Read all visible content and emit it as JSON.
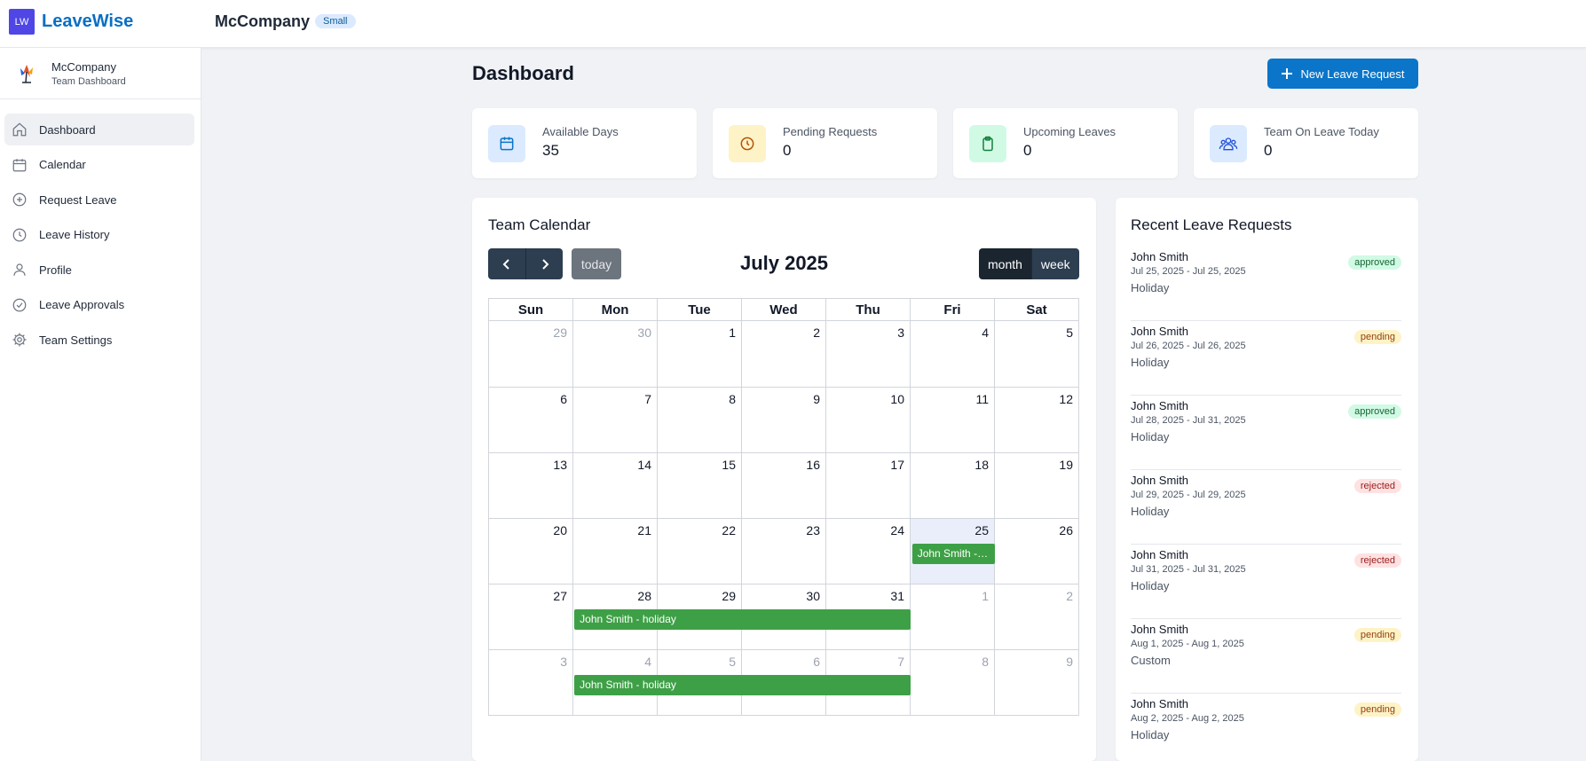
{
  "header": {
    "logo_initials": "LW",
    "app_name": "LeaveWise",
    "company": "McCompany",
    "company_size": "Small"
  },
  "sidebar": {
    "org_name": "McCompany",
    "org_subtitle": "Team Dashboard",
    "items": [
      {
        "label": "Dashboard",
        "icon": "home-icon",
        "active": true
      },
      {
        "label": "Calendar",
        "icon": "calendar-icon"
      },
      {
        "label": "Request Leave",
        "icon": "plus-circle-icon"
      },
      {
        "label": "Leave History",
        "icon": "clock-icon"
      },
      {
        "label": "Profile",
        "icon": "user-icon"
      },
      {
        "label": "Leave Approvals",
        "icon": "check-circle-icon"
      },
      {
        "label": "Team Settings",
        "icon": "gear-icon"
      }
    ]
  },
  "main": {
    "title": "Dashboard",
    "new_request_label": "New Leave Request"
  },
  "stats": [
    {
      "label": "Available Days",
      "value": "35",
      "icon": "calendar-icon",
      "color": "#dbeafe"
    },
    {
      "label": "Pending Requests",
      "value": "0",
      "icon": "clock-icon",
      "color": "#fef3c7"
    },
    {
      "label": "Upcoming Leaves",
      "value": "0",
      "icon": "clipboard-icon",
      "color": "#d1fae5"
    },
    {
      "label": "Team On Leave Today",
      "value": "0",
      "icon": "team-icon",
      "color": "#dbeafe"
    }
  ],
  "calendar": {
    "title": "Team Calendar",
    "today_label": "today",
    "month_label": "July 2025",
    "view_month": "month",
    "view_week": "week",
    "weekdays": [
      "Sun",
      "Mon",
      "Tue",
      "Wed",
      "Thu",
      "Fri",
      "Sat"
    ],
    "weeks": [
      [
        "29",
        "30",
        "1",
        "2",
        "3",
        "4",
        "5"
      ],
      [
        "6",
        "7",
        "8",
        "9",
        "10",
        "11",
        "12"
      ],
      [
        "13",
        "14",
        "15",
        "16",
        "17",
        "18",
        "19"
      ],
      [
        "20",
        "21",
        "22",
        "23",
        "24",
        "25",
        "26"
      ],
      [
        "27",
        "28",
        "29",
        "30",
        "31",
        "1",
        "2"
      ],
      [
        "3",
        "4",
        "5",
        "6",
        "7",
        "8",
        "9"
      ]
    ],
    "events": [
      {
        "label": "John Smith - holiday",
        "display": "John Smith -…"
      },
      {
        "label": "John Smith - holiday"
      },
      {
        "label": "John Smith - holiday"
      }
    ]
  },
  "recent": {
    "title": "Recent Leave Requests",
    "items": [
      {
        "name": "John Smith",
        "dates": "Jul 25, 2025 - Jul 25, 2025",
        "type": "Holiday",
        "status": "approved"
      },
      {
        "name": "John Smith",
        "dates": "Jul 26, 2025 - Jul 26, 2025",
        "type": "Holiday",
        "status": "pending"
      },
      {
        "name": "John Smith",
        "dates": "Jul 28, 2025 - Jul 31, 2025",
        "type": "Holiday",
        "status": "approved"
      },
      {
        "name": "John Smith",
        "dates": "Jul 29, 2025 - Jul 29, 2025",
        "type": "Holiday",
        "status": "rejected"
      },
      {
        "name": "John Smith",
        "dates": "Jul 31, 2025 - Jul 31, 2025",
        "type": "Holiday",
        "status": "rejected"
      },
      {
        "name": "John Smith",
        "dates": "Aug 1, 2025 - Aug 1, 2025",
        "type": "Custom",
        "status": "pending"
      },
      {
        "name": "John Smith",
        "dates": "Aug 2, 2025 - Aug 2, 2025",
        "type": "Holiday",
        "status": "pending"
      }
    ]
  }
}
